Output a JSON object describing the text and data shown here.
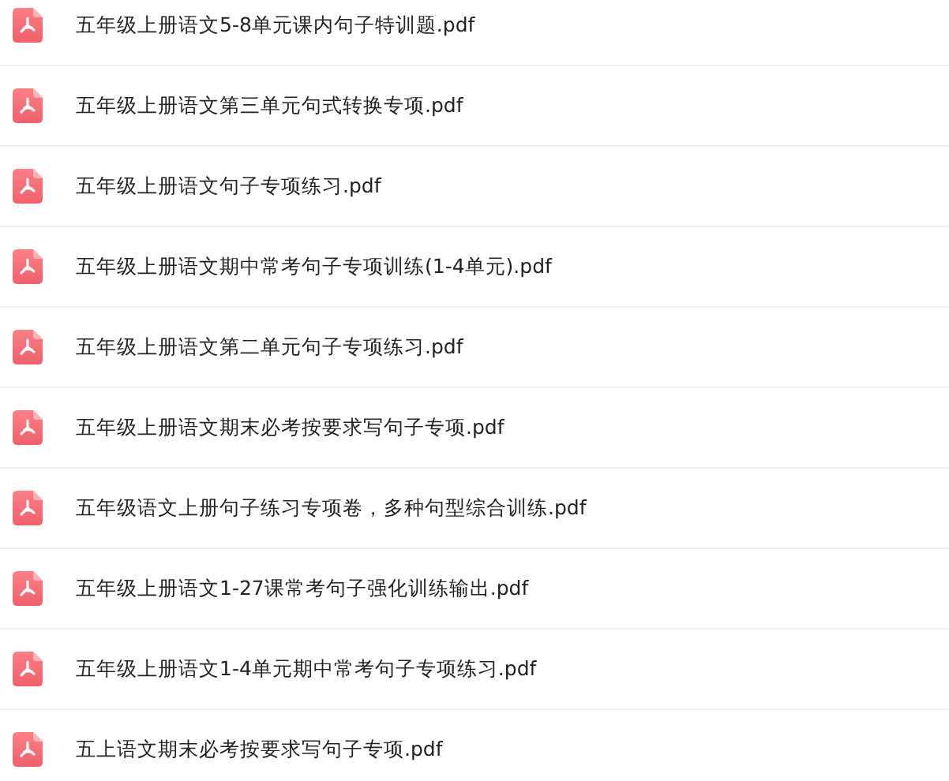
{
  "files": [
    {
      "name": "五年级上册语文5-8单元课内句子特训题.pdf"
    },
    {
      "name": "五年级上册语文第三单元句式转换专项.pdf"
    },
    {
      "name": "五年级上册语文句子专项练习.pdf"
    },
    {
      "name": "五年级上册语文期中常考句子专项训练(1-4单元).pdf"
    },
    {
      "name": "五年级上册语文第二单元句子专项练习.pdf"
    },
    {
      "name": "五年级上册语文期末必考按要求写句子专项.pdf"
    },
    {
      "name": "五年级语文上册句子练习专项卷，多种句型综合训练.pdf"
    },
    {
      "name": "五年级上册语文1-27课常考句子强化训练输出.pdf"
    },
    {
      "name": "五年级上册语文1-4单元期中常考句子专项练习.pdf"
    },
    {
      "name": "五上语文期末必考按要求写句子专项.pdf"
    }
  ]
}
